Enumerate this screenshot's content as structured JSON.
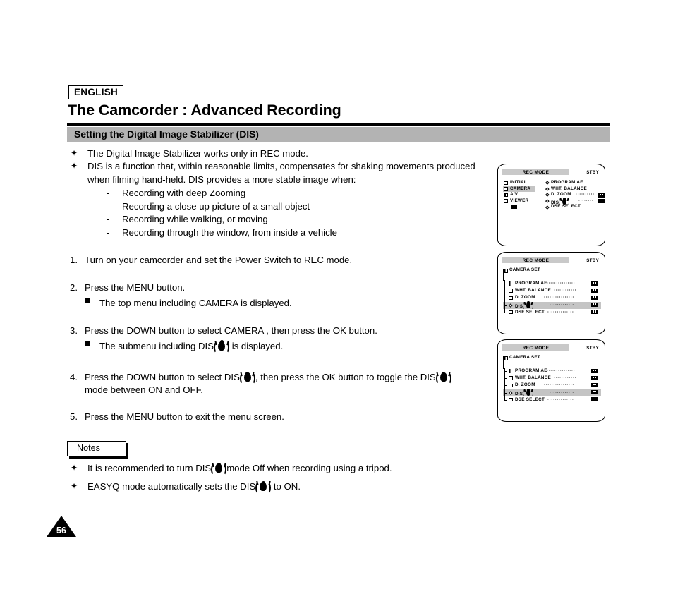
{
  "document": {
    "language_tag": "ENGLISH",
    "title": "The Camcorder : Advanced Recording",
    "section_heading": "Setting the Digital Image Stabilizer (DIS)",
    "page_number": "56"
  },
  "intro_bullets": [
    {
      "text": "The Digital Image Stabilizer works only in REC mode.",
      "sub_items": []
    },
    {
      "text": "DIS is a function that, within reasonable limits, compensates for shaking movements produced when filming hand-held. DIS provides a more stable image when:",
      "sub_items": [
        "Recording with deep Zooming",
        "Recording a close up picture of a small object",
        "Recording while walking, or moving",
        "Recording through the window, from inside a vehicle"
      ]
    }
  ],
  "steps": [
    {
      "number": "1.",
      "text": "Turn on your camcorder and set the Power Switch to REC mode.",
      "sub": null
    },
    {
      "number": "2.",
      "text": "Press the MENU button.",
      "sub_pre": "The top menu including  CAMERA  is displayed.",
      "sub_post": ""
    },
    {
      "number": "3.",
      "text": "Press the DOWN button to select  CAMERA , then press the OK button.",
      "sub_pre": "The submenu including  DIS",
      "sub_post": "is displayed."
    },
    {
      "number": "4.",
      "text_pre": "Press the DOWN button to select  DIS",
      "text_mid": ", then press the OK button to toggle the DIS",
      "text_post": "mode between ON and OFF.",
      "sub": null
    },
    {
      "number": "5.",
      "text": "Press the MENU button to exit the menu screen.",
      "sub": null
    }
  ],
  "notes": {
    "label": "Notes",
    "items": [
      {
        "pre": "It is recommended to turn DIS",
        "post": "mode Off when recording using a tripod."
      },
      {
        "pre": "EASYQ mode automatically sets the DIS",
        "post": "to ON."
      }
    ]
  },
  "lcd_screens": [
    {
      "id": "screen-top-menu",
      "rec_mode": "REC MODE",
      "status": "STBY",
      "left_items": [
        {
          "label": "INITIAL",
          "icon": "folder-outline",
          "selected": false
        },
        {
          "label": "CAMERA",
          "icon": "folder-outline",
          "selected": true
        },
        {
          "label": "A/V",
          "icon": "folder-half",
          "selected": false
        },
        {
          "label": "VIEWER",
          "icon": "folder-outline",
          "selected": false
        }
      ],
      "right_items": [
        {
          "label": "PROGRAM AE",
          "dots": "",
          "value_icon": "none"
        },
        {
          "label": "WHT. BALANCE",
          "dots": "",
          "value_icon": "none"
        },
        {
          "label": "D. ZOOM",
          "dots": "··········",
          "value_icon": "dual-box"
        },
        {
          "label": "DIS",
          "dots": "········",
          "value_icon": "solid-box",
          "has_dis_icon": true
        },
        {
          "label": "DSE SELECT",
          "dots": "",
          "value_icon": "none"
        }
      ]
    },
    {
      "id": "screen-submenu-a",
      "rec_mode": "REC MODE",
      "status": "STBY",
      "header": "CAMERA SET",
      "rows": [
        {
          "label": "PROGRAM AE",
          "icon": "folder-outline",
          "dots": "···············",
          "value_icon": "split-box",
          "selected": false
        },
        {
          "label": "WHT. BALANCE",
          "icon": "folder-outline",
          "dots": "············",
          "value_icon": "split-box",
          "selected": false
        },
        {
          "label": "D. ZOOM",
          "icon": "folder-outline",
          "dots": "················",
          "value_icon": "dual-box",
          "selected": false
        },
        {
          "label": "DIS",
          "icon": "diamond",
          "dots": "·············",
          "value_icon": "dual-box",
          "selected": true,
          "has_dis_icon": true
        },
        {
          "label": "DSE SELECT",
          "icon": "folder-outline",
          "dots": "··············",
          "value_icon": "dual-box",
          "selected": false,
          "last": true
        }
      ]
    },
    {
      "id": "screen-submenu-b",
      "rec_mode": "REC MODE",
      "status": "STBY",
      "header": "CAMERA SET",
      "rows": [
        {
          "label": "PROGRAM AE",
          "icon": "folder-outline",
          "dots": "···············",
          "value_icon": "split-box",
          "selected": false
        },
        {
          "label": "WHT. BALANCE",
          "icon": "folder-outline",
          "dots": "············",
          "value_icon": "split-box",
          "selected": false
        },
        {
          "label": "D. ZOOM",
          "icon": "folder-outline",
          "dots": "················",
          "value_icon": "dual-box",
          "selected": false
        },
        {
          "label": "DIS",
          "icon": "diamond",
          "dots": "·············",
          "value_icon": "on-box",
          "selected": true,
          "has_dis_icon": true
        },
        {
          "label": "DSE SELECT",
          "icon": "folder-outline",
          "dots": "··············",
          "value_icon": "solid-box",
          "selected": false,
          "last": true
        }
      ]
    }
  ],
  "glyphs": {
    "bullet": "✦",
    "dash": "-"
  },
  "colors": {
    "section_bar": "#b3b3b3",
    "lcd_highlight": "#c4c4c4",
    "rec_bar": "#c9c9c9",
    "ink": "#000000",
    "paper": "#ffffff"
  }
}
